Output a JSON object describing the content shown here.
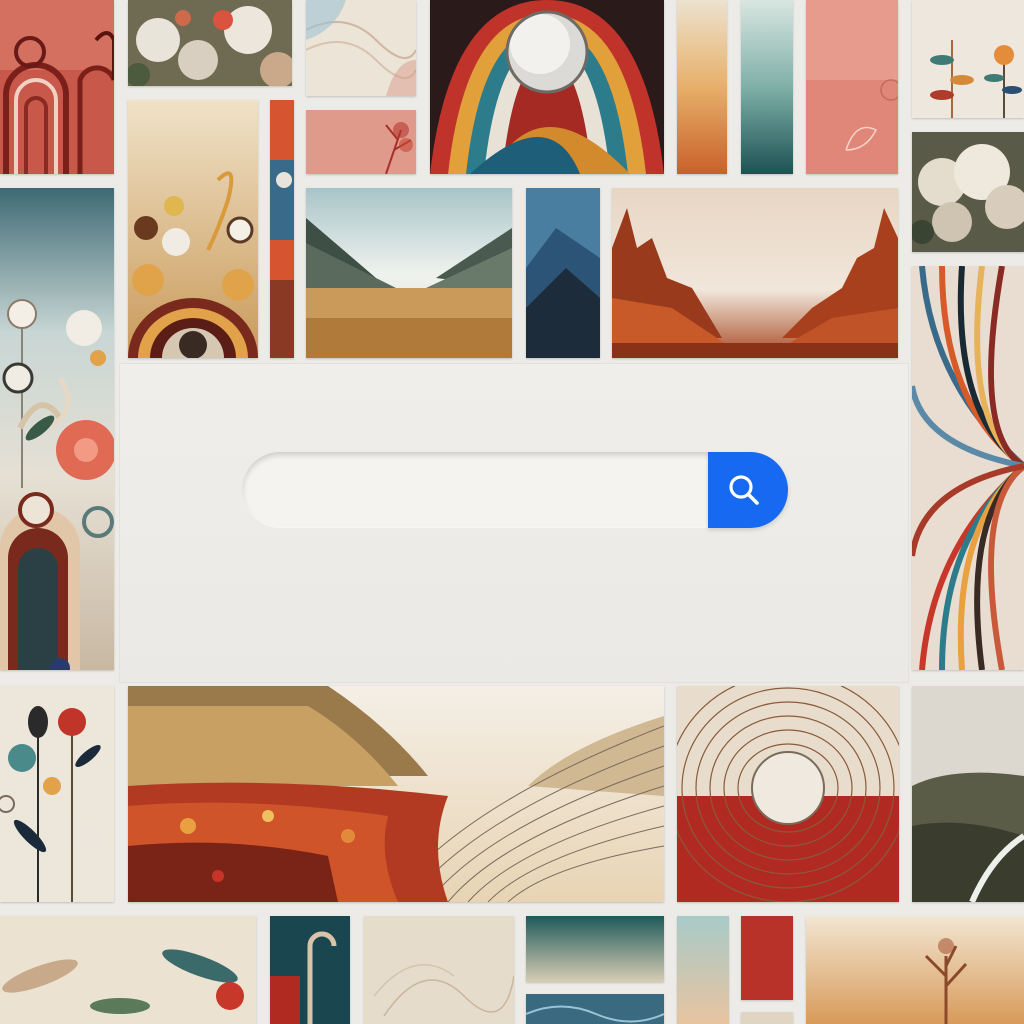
{
  "search": {
    "value": "",
    "placeholder": "",
    "button_icon": "search-icon"
  },
  "colors": {
    "accent": "#1669f0",
    "background": "#ecebe7",
    "panel": "#eeede9"
  }
}
